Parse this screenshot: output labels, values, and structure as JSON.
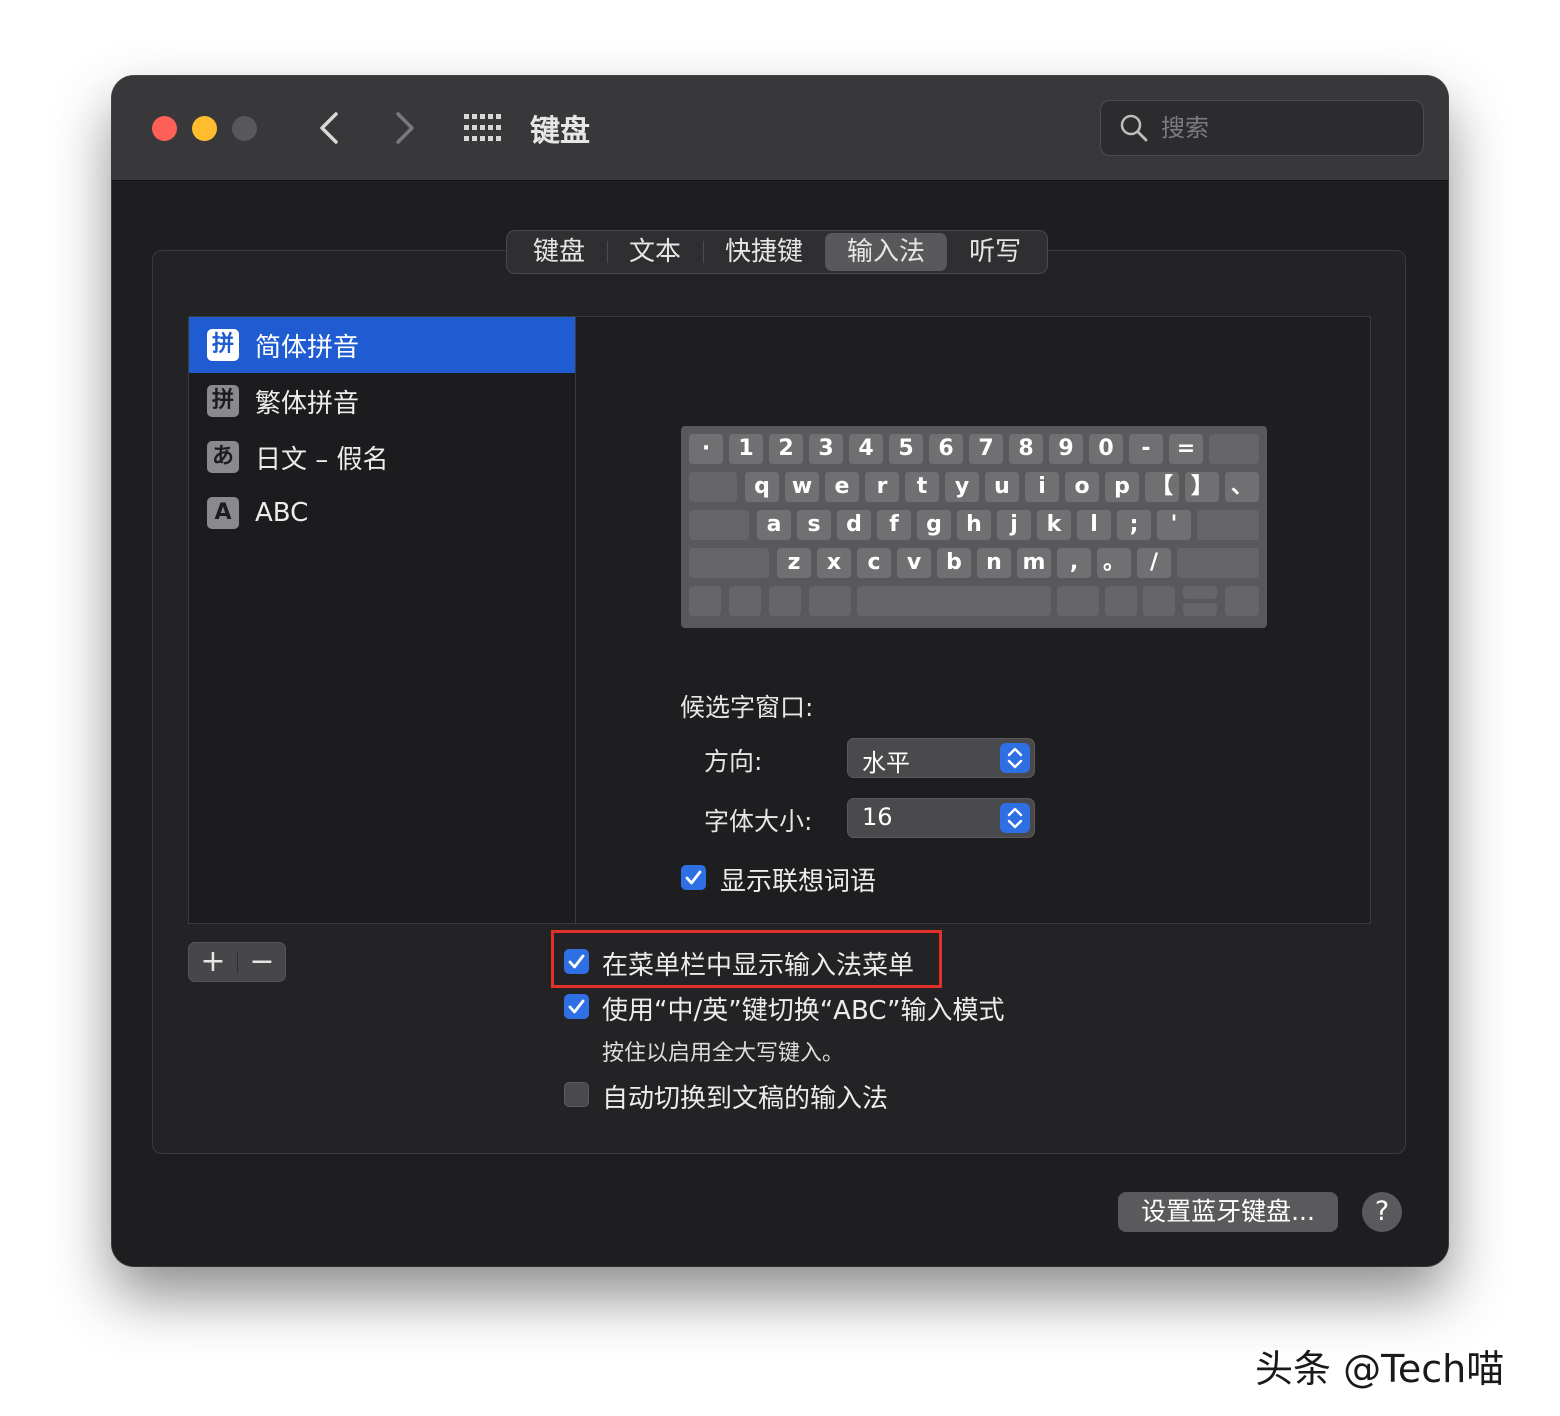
{
  "window": {
    "title": "键盘",
    "search_placeholder": "搜索"
  },
  "tabs": [
    {
      "label": "键盘",
      "active": false
    },
    {
      "label": "文本",
      "active": false
    },
    {
      "label": "快捷键",
      "active": false
    },
    {
      "label": "输入法",
      "active": true
    },
    {
      "label": "听写",
      "active": false
    }
  ],
  "input_sources": [
    {
      "icon": "拼",
      "label": "简体拼音",
      "selected": true
    },
    {
      "icon": "拼",
      "label": "繁体拼音",
      "selected": false
    },
    {
      "icon": "あ",
      "label": "日文 – 假名",
      "selected": false
    },
    {
      "icon": "A",
      "label": "ABC",
      "selected": false
    }
  ],
  "keyboard": {
    "row1": [
      "·",
      "1",
      "2",
      "3",
      "4",
      "5",
      "6",
      "7",
      "8",
      "9",
      "0",
      "-",
      "="
    ],
    "row2": [
      "q",
      "w",
      "e",
      "r",
      "t",
      "y",
      "u",
      "i",
      "o",
      "p",
      "【",
      "】",
      "、"
    ],
    "row3": [
      "a",
      "s",
      "d",
      "f",
      "g",
      "h",
      "j",
      "k",
      "l",
      ";",
      "'"
    ],
    "row4": [
      "z",
      "x",
      "c",
      "v",
      "b",
      "n",
      "m",
      ",",
      "。",
      "/"
    ]
  },
  "candidate": {
    "section_label": "候选字窗口:",
    "direction_label": "方向:",
    "direction_value": "水平",
    "font_size_label": "字体大小:",
    "font_size_value": "16",
    "show_predictions_label": "显示联想词语",
    "show_predictions_checked": true
  },
  "options": {
    "show_menu_label": "在菜单栏中显示输入法菜单",
    "show_menu_checked": true,
    "toggle_abc_label": "使用“中/英”键切换“ABC”输入模式",
    "toggle_abc_checked": true,
    "toggle_abc_hint": "按住以启用全大写键入。",
    "auto_switch_label": "自动切换到文稿的输入法",
    "auto_switch_checked": false
  },
  "list_controls": {
    "add": "+",
    "remove": "−"
  },
  "buttons": {
    "bluetooth": "设置蓝牙键盘...",
    "help": "?"
  },
  "watermark": "头条 @Tech喵",
  "colors": {
    "accent": "#2f6fe4",
    "selection": "#1f5bd1",
    "highlight_box": "#e2312a",
    "close": "#fe5f57",
    "minimize": "#febc2e"
  }
}
